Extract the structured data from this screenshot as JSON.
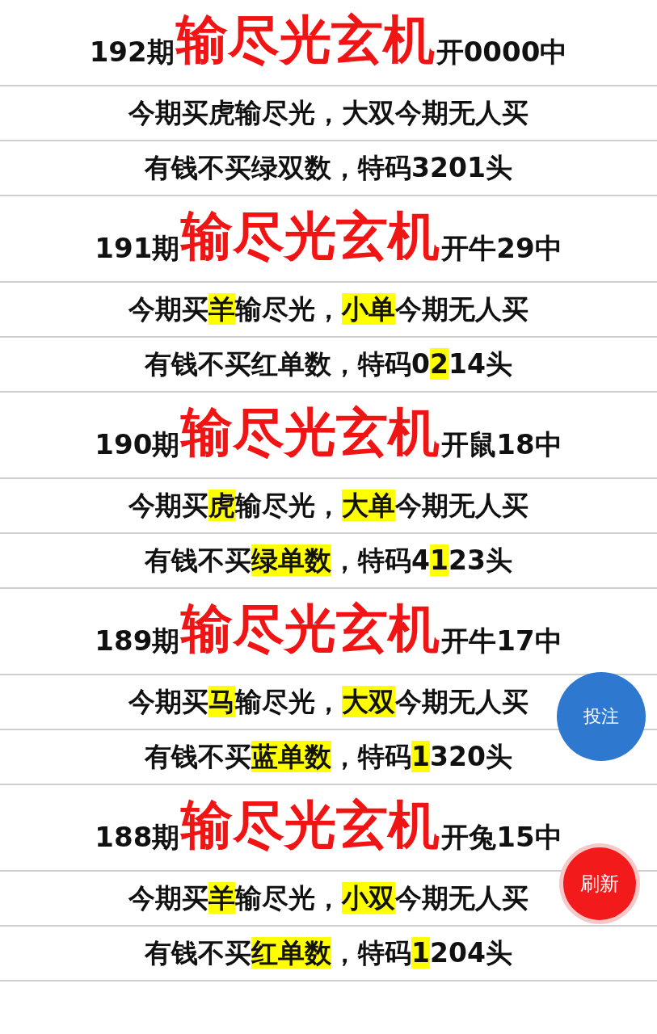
{
  "blocks": [
    {
      "issue": "192期",
      "title": "输尽光玄机",
      "result": "开0000中",
      "lines": [
        [
          {
            "text": "今期买虎输尽光，大双今期无人买",
            "highlight": false
          }
        ],
        [
          {
            "text": "有钱不买绿双数，特码3201头",
            "highlight": false
          }
        ]
      ]
    },
    {
      "issue": "191期",
      "title": "输尽光玄机",
      "result": "开牛29中",
      "lines": [
        [
          {
            "text": "今期买",
            "highlight": false
          },
          {
            "text": "羊",
            "highlight": true
          },
          {
            "text": "输尽光，",
            "highlight": false
          },
          {
            "text": "小单",
            "highlight": true
          },
          {
            "text": "今期无人买",
            "highlight": false
          }
        ],
        [
          {
            "text": "有钱不买红单数，特码0",
            "highlight": false
          },
          {
            "text": "2",
            "highlight": true
          },
          {
            "text": "14头",
            "highlight": false
          }
        ]
      ]
    },
    {
      "issue": "190期",
      "title": "输尽光玄机",
      "result": "开鼠18中",
      "lines": [
        [
          {
            "text": "今期买",
            "highlight": false
          },
          {
            "text": "虎",
            "highlight": true
          },
          {
            "text": "输尽光，",
            "highlight": false
          },
          {
            "text": "大单",
            "highlight": true
          },
          {
            "text": "今期无人买",
            "highlight": false
          }
        ],
        [
          {
            "text": "有钱不买",
            "highlight": false
          },
          {
            "text": "绿单数",
            "highlight": true
          },
          {
            "text": "，特码4",
            "highlight": false
          },
          {
            "text": "1",
            "highlight": true
          },
          {
            "text": "23头",
            "highlight": false
          }
        ]
      ]
    },
    {
      "issue": "189期",
      "title": "输尽光玄机",
      "result": "开牛17中",
      "lines": [
        [
          {
            "text": "今期买",
            "highlight": false
          },
          {
            "text": "马",
            "highlight": true
          },
          {
            "text": "输尽光，",
            "highlight": false
          },
          {
            "text": "大双",
            "highlight": true
          },
          {
            "text": "今期无人买",
            "highlight": false
          }
        ],
        [
          {
            "text": "有钱不买",
            "highlight": false
          },
          {
            "text": "蓝单数",
            "highlight": true
          },
          {
            "text": "，特码",
            "highlight": false
          },
          {
            "text": "1",
            "highlight": true
          },
          {
            "text": "320头",
            "highlight": false
          }
        ]
      ]
    },
    {
      "issue": "188期",
      "title": "输尽光玄机",
      "result": "开兔15中",
      "lines": [
        [
          {
            "text": "今期买",
            "highlight": false
          },
          {
            "text": "羊",
            "highlight": true
          },
          {
            "text": "输尽光，",
            "highlight": false
          },
          {
            "text": "小双",
            "highlight": true
          },
          {
            "text": "今期无人买",
            "highlight": false
          }
        ],
        [
          {
            "text": "有钱不买",
            "highlight": false
          },
          {
            "text": "红单数",
            "highlight": true
          },
          {
            "text": "，特码",
            "highlight": false
          },
          {
            "text": "1",
            "highlight": true
          },
          {
            "text": "204头",
            "highlight": false
          }
        ]
      ]
    }
  ],
  "floating_buttons": [
    {
      "label": "投注",
      "kind": "bet"
    },
    {
      "label": "刷新",
      "kind": "refresh"
    }
  ]
}
